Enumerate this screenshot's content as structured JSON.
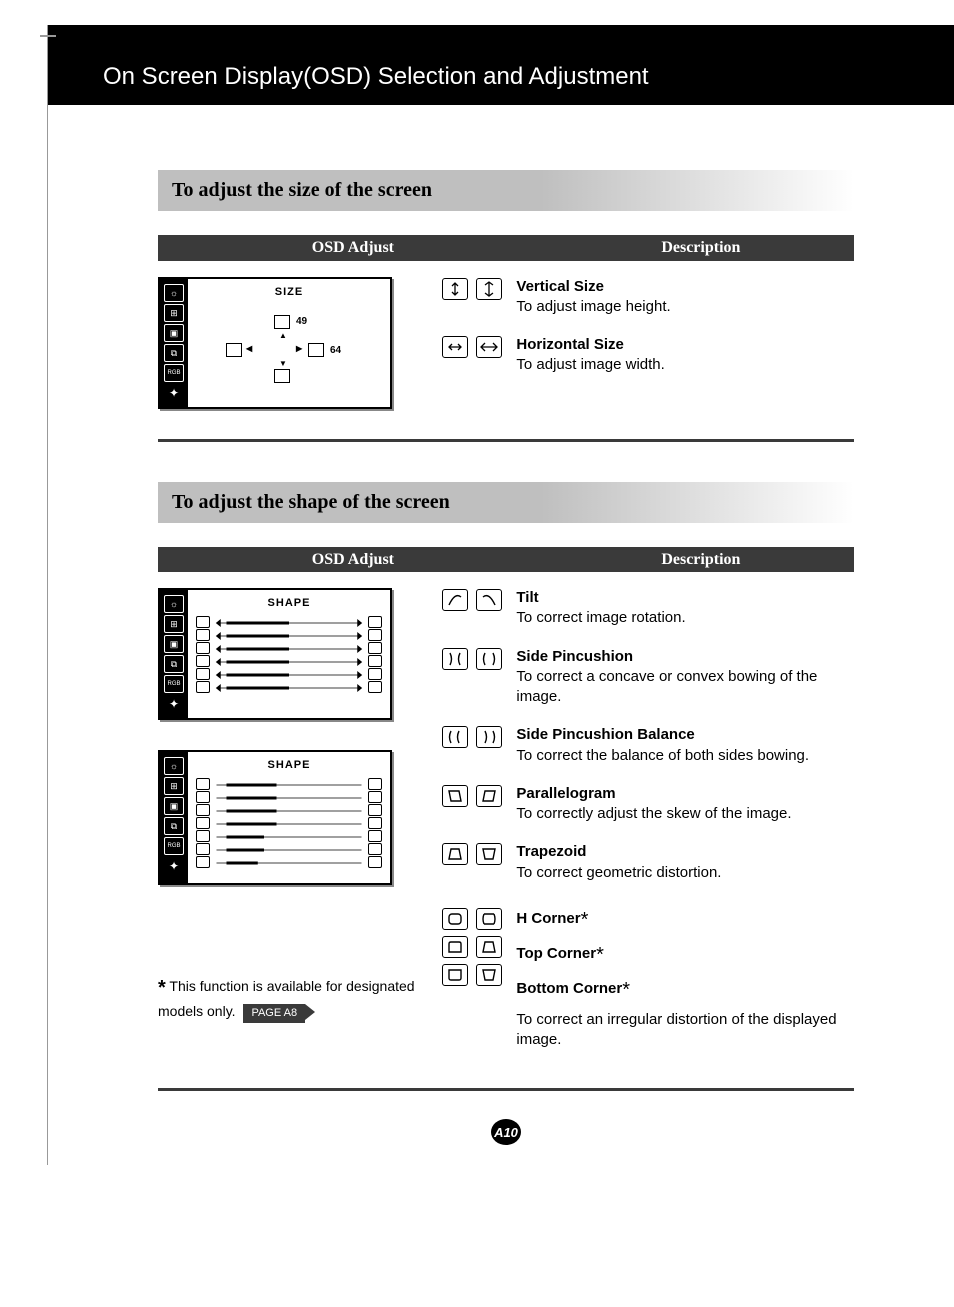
{
  "header": {
    "title": "On Screen Display(OSD) Selection and Adjustment"
  },
  "section1": {
    "title": "To adjust the size of the screen",
    "cols": {
      "left": "OSD Adjust",
      "right": "Description"
    },
    "osd": {
      "title": "SIZE",
      "val_top": "49",
      "val_right": "64"
    },
    "items": [
      {
        "name": "Vertical Size",
        "body": "To adjust image height."
      },
      {
        "name": "Horizontal Size",
        "body": "To adjust image width."
      }
    ]
  },
  "section2": {
    "title": "To adjust the shape of the screen",
    "cols": {
      "left": "OSD Adjust",
      "right": "Description"
    },
    "osd1": {
      "title": "SHAPE"
    },
    "osd2": {
      "title": "SHAPE"
    },
    "items": [
      {
        "name": "Tilt",
        "body": "To correct image rotation."
      },
      {
        "name": "Side Pincushion",
        "body": "To correct a concave or convex bowing of the image."
      },
      {
        "name": "Side Pincushion Balance",
        "body": "To correct the balance of both sides bowing."
      },
      {
        "name": "Parallelogram",
        "body": "To correctly adjust the skew of the image."
      },
      {
        "name": "Trapezoid",
        "body": "To correct geometric distortion."
      },
      {
        "name_a": "H Corner",
        "name_b": "Top Corner",
        "name_c": "Bottom Corner",
        "body": "To correct an irregular distortion of the displayed image."
      }
    ],
    "footnote": {
      "star": "*",
      "text": " This function is available for designated models only.",
      "tag": "PAGE A8"
    }
  },
  "pagenum": "A10"
}
